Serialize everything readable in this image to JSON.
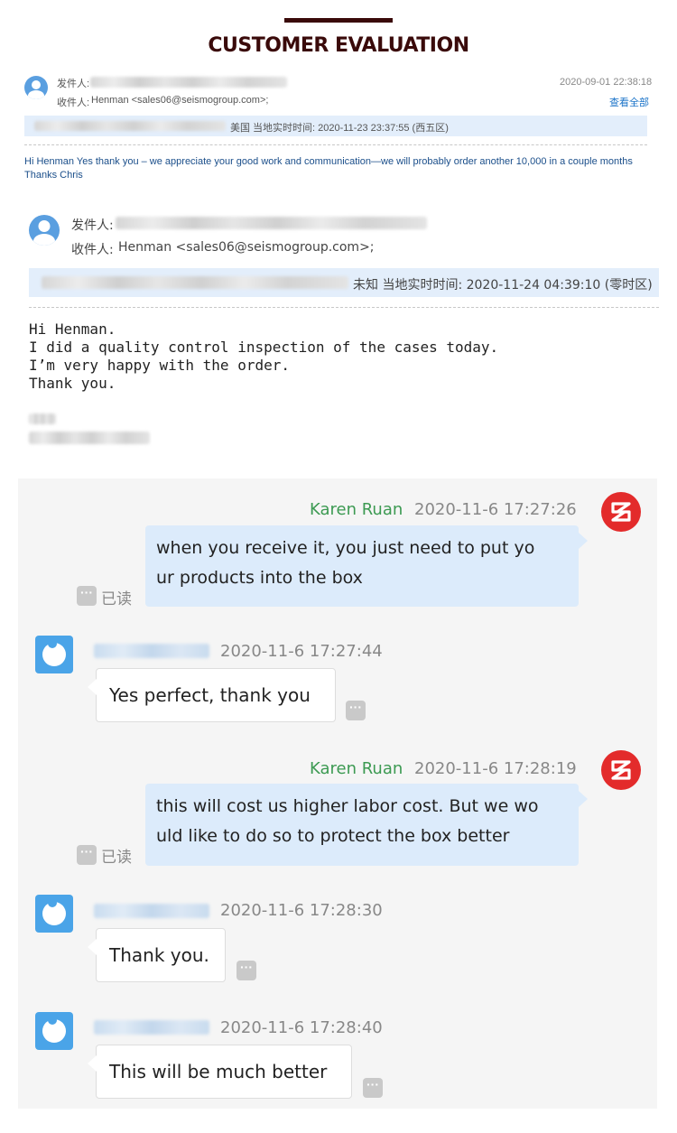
{
  "header": {
    "title": "CUSTOMER EVALUATION"
  },
  "email1": {
    "from_label": "发件人:",
    "to_label": "收件人:",
    "to_value": "Henman <sales06@seismogroup.com>;",
    "date": "2020-09-01 22:38:18",
    "view_all": "查看全部",
    "local_time": "美国 当地实时时间: 2020-11-23 23:37:55 (西五区)",
    "body": "Hi Henman Yes thank you – we appreciate your good work and communication—we will probably order another 10,000 in a couple months Thanks Chris"
  },
  "email2": {
    "from_label": "发件人:",
    "to_label": "收件人:",
    "to_value": "Henman <sales06@seismogroup.com>;",
    "local_time": "未知 当地实时时间: 2020-11-24 04:39:10 (零时区)",
    "body_lines": [
      "Hi Henman.",
      "I did a quality control inspection of the cases today.",
      "I’m very happy with the order.",
      "Thank you."
    ]
  },
  "chat": {
    "read_label": "已读",
    "more_glyph": "···",
    "messages": [
      {
        "sender": "Karen Ruan",
        "time": "2020-11-6 17:27:26",
        "line1": "when you receive it, you just need to put yo",
        "line2": "ur products into the box"
      },
      {
        "time": "2020-11-6 17:27:44",
        "text": "Yes perfect, thank you"
      },
      {
        "sender": "Karen Ruan",
        "time": "2020-11-6 17:28:19",
        "line1": "this will cost us higher labor cost. But we wo",
        "line2": "uld like to do so to protect the box better"
      },
      {
        "time": "2020-11-6 17:28:30",
        "text": "Thank you."
      },
      {
        "time": "2020-11-6 17:28:40",
        "text": "This will be much better"
      }
    ]
  },
  "colors": {
    "title": "#3a0a0a",
    "sender_name": "#3c9a52",
    "bubble_out": "#dcebfb",
    "logo": "#e32b2b"
  }
}
